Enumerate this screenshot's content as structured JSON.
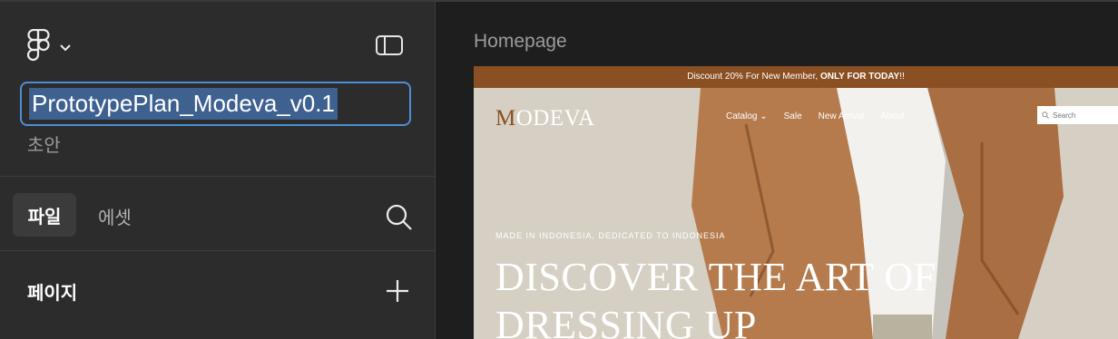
{
  "sidebar": {
    "file_name": "PrototypePlan_Modeva_v0.1",
    "status": "초안",
    "tabs": {
      "files": "파일",
      "assets": "에셋"
    },
    "pages_title": "페이지"
  },
  "canvas": {
    "frame_label": "Homepage",
    "site": {
      "promo_text": "Discount 20% For New Member, ",
      "promo_bold": "ONLY FOR TODAY",
      "promo_suffix": "!!",
      "brand_initial": "M",
      "brand_rest": "ODEVA",
      "nav": [
        "Catalog",
        "Sale",
        "New Arrival",
        "About"
      ],
      "search_placeholder": "Search",
      "hero_subtitle": "MADE IN INDONESIA, DEDICATED TO INDONESIA",
      "hero_title": "DISCOVER THE ART OF DRESSING UP"
    }
  },
  "colors": {
    "sidebar_bg": "#2c2c2c",
    "canvas_bg": "#1e1e1e",
    "selection_blue": "#4c8fd6",
    "brand_brown": "#8a4f22"
  },
  "icons": [
    "figma-logo-icon",
    "chevron-down-icon",
    "panel-toggle-icon",
    "search-icon",
    "plus-icon",
    "coat-photo"
  ]
}
